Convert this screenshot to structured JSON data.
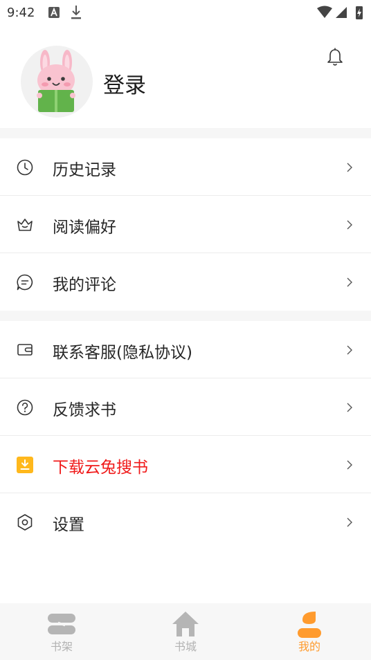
{
  "status_bar": {
    "time": "9:42"
  },
  "profile": {
    "login_label": "登录"
  },
  "menu_group1": [
    {
      "label": "历史记录",
      "icon": "clock-icon"
    },
    {
      "label": "阅读偏好",
      "icon": "crown-icon"
    },
    {
      "label": "我的评论",
      "icon": "comment-icon"
    }
  ],
  "menu_group2": [
    {
      "label": "联系客服(隐私协议)",
      "icon": "wallet-icon"
    },
    {
      "label": "反馈求书",
      "icon": "question-icon"
    },
    {
      "label": "下载云兔搜书",
      "icon": "download-icon",
      "color": "#f01919"
    },
    {
      "label": "设置",
      "icon": "settings-icon"
    }
  ],
  "tab_bar": {
    "tabs": [
      {
        "label": "书架",
        "icon": "bookshelf-icon",
        "active": false
      },
      {
        "label": "书城",
        "icon": "home-icon",
        "active": false
      },
      {
        "label": "我的",
        "icon": "profile-icon",
        "active": true
      }
    ]
  },
  "colors": {
    "accent": "#ff9b2e",
    "download_badge": "#ffb81c",
    "highlight_text": "#f01919",
    "inactive": "#b2b2b2"
  }
}
